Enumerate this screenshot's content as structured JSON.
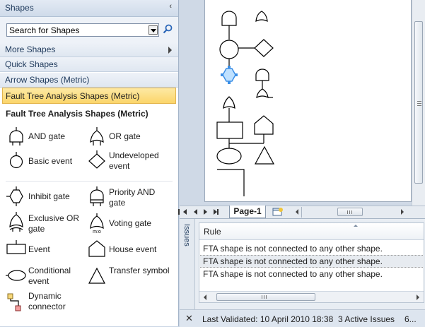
{
  "shapes_panel": {
    "title": "Shapes",
    "collapse_glyph": "‹",
    "search": {
      "value": "Search for Shapes",
      "icon": "magnifier-icon"
    },
    "stencils": [
      {
        "label": "More Shapes",
        "has_arrow": true
      },
      {
        "label": "Quick Shapes"
      },
      {
        "label": "Arrow Shapes (Metric)"
      },
      {
        "label": "Fault Tree Analysis Shapes (Metric)",
        "active": true
      }
    ],
    "stencil_title": "Fault Tree Analysis Shapes (Metric)",
    "masters": [
      {
        "label": "AND gate",
        "icon": "and-gate-icon"
      },
      {
        "label": "OR gate",
        "icon": "or-gate-icon"
      },
      {
        "label": "Basic event",
        "icon": "basic-event-icon"
      },
      {
        "label": "Undeveloped event",
        "icon": "undeveloped-event-icon"
      },
      {
        "label": "Inhibit gate",
        "icon": "inhibit-gate-icon"
      },
      {
        "label": "Priority AND gate",
        "icon": "priority-and-gate-icon"
      },
      {
        "label": "Exclusive OR gate",
        "icon": "exclusive-or-gate-icon"
      },
      {
        "label": "Voting gate",
        "icon": "voting-gate-icon",
        "icon_text": "m:o"
      },
      {
        "label": "Event",
        "icon": "event-icon"
      },
      {
        "label": "House event",
        "icon": "house-event-icon"
      },
      {
        "label": "Conditional event",
        "icon": "conditional-event-icon"
      },
      {
        "label": "Transfer symbol",
        "icon": "transfer-symbol-icon"
      },
      {
        "label": "Dynamic connector",
        "icon": "dynamic-connector-icon"
      }
    ]
  },
  "page_tabs": {
    "active_tab": "Page-1",
    "insert_icon": "insert-page-icon"
  },
  "issues": {
    "panel_label": "Issues",
    "column_header": "Rule",
    "rows": [
      {
        "text": "FTA shape is not connected to any other shape.",
        "selected": false
      },
      {
        "text": "FTA shape is not connected to any other shape.",
        "selected": true
      },
      {
        "text": "FTA shape is not connected to any other shape.",
        "selected": false
      }
    ],
    "close_glyph": "✕",
    "last_validated": "Last Validated: 10 April 2010 18:38",
    "active_issues": "3 Active Issues",
    "overflow_text": "6..."
  },
  "colors": {
    "active_stencil": "#fbd56a",
    "selection": "#3a8ee6",
    "chrome_blue": "#c9d5e4"
  }
}
